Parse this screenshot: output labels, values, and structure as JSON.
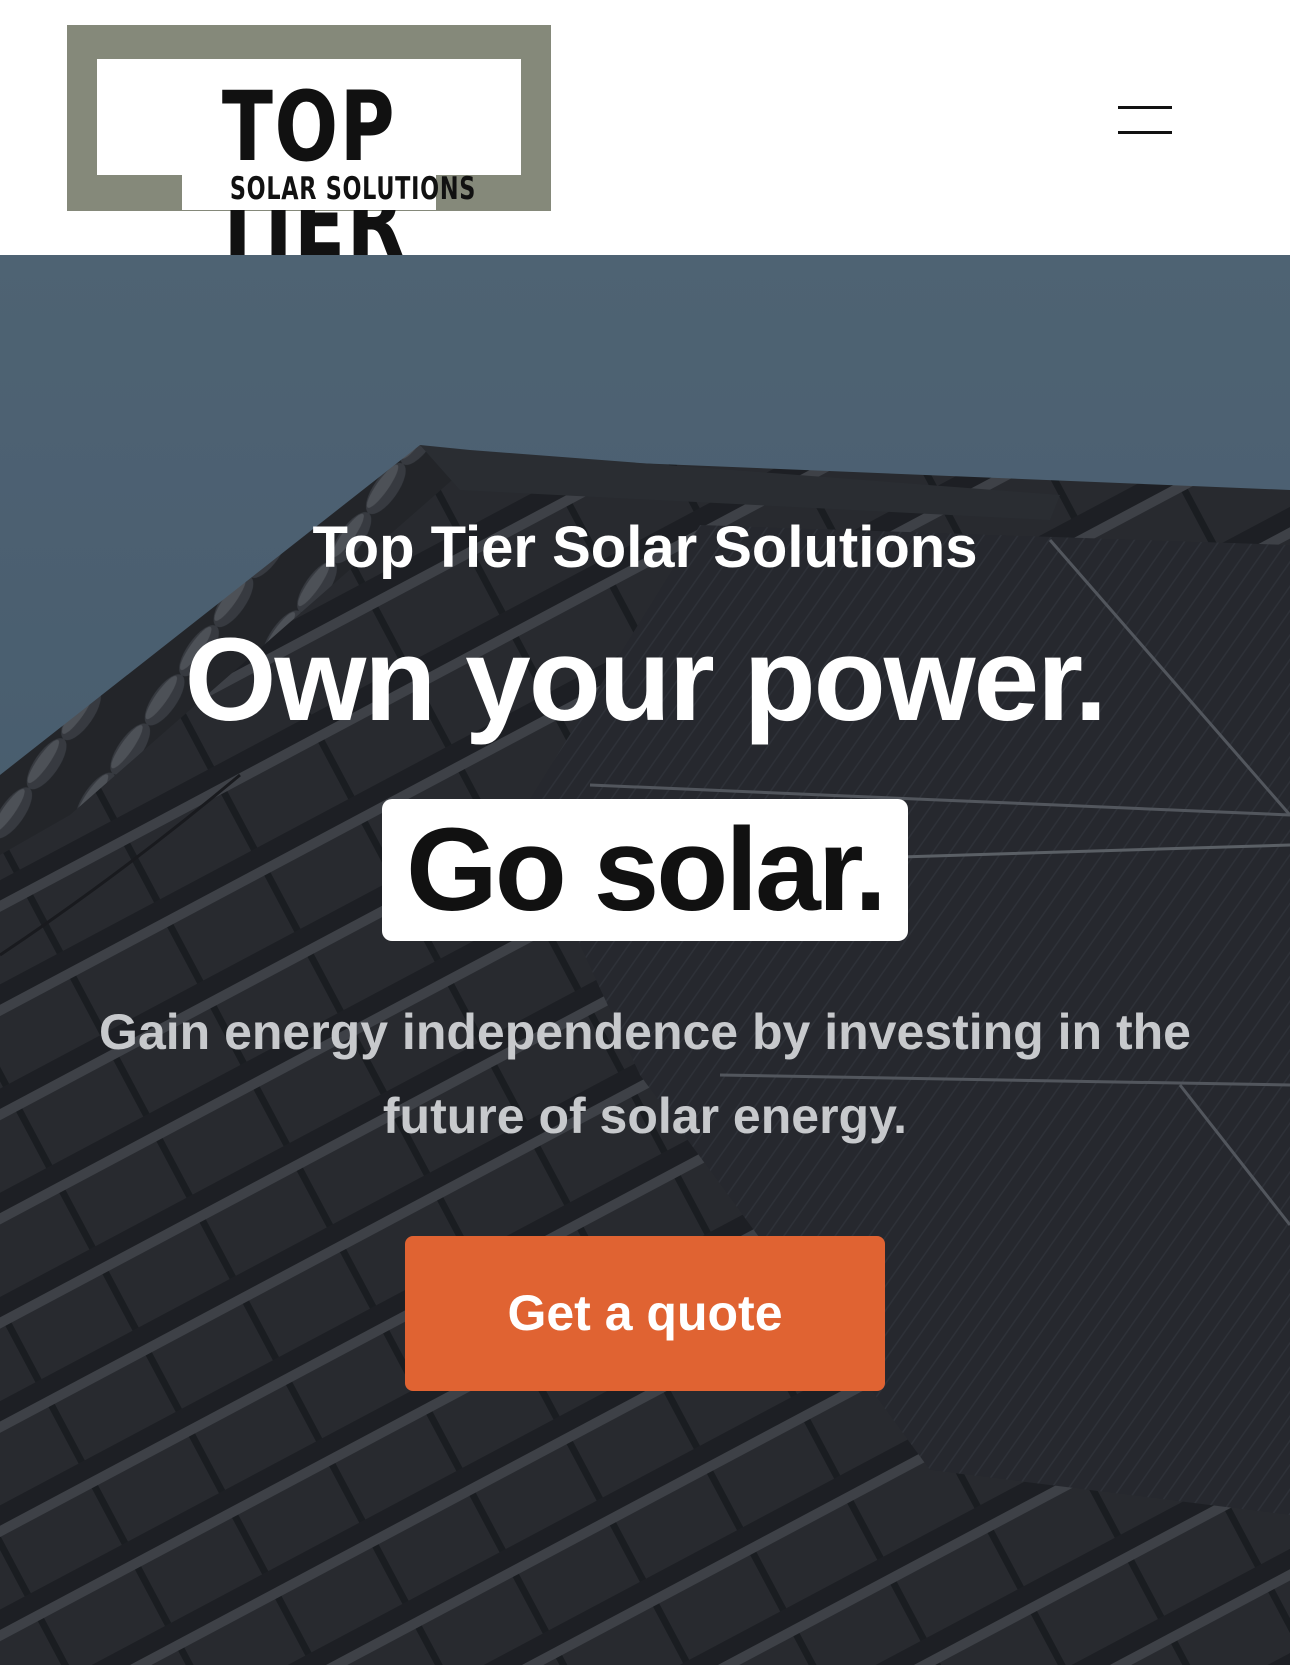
{
  "header": {
    "logo": {
      "title": "TOP TIER",
      "tagline": "SOLAR SOLUTIONS"
    },
    "menu_icon": "hamburger-menu-icon"
  },
  "hero": {
    "kicker": "Top Tier Solar Solutions",
    "title": "Own your power.",
    "highlight": "Go solar.",
    "subtitle": "Gain energy independence by investing in the future of solar energy.",
    "cta_label": "Get a quote",
    "background_image": "roof-with-solar-panels"
  },
  "colors": {
    "logo_frame": "#85897a",
    "cta": "#e06332",
    "subtitle_text": "#c7c9cc",
    "sky": "#5a7489"
  }
}
